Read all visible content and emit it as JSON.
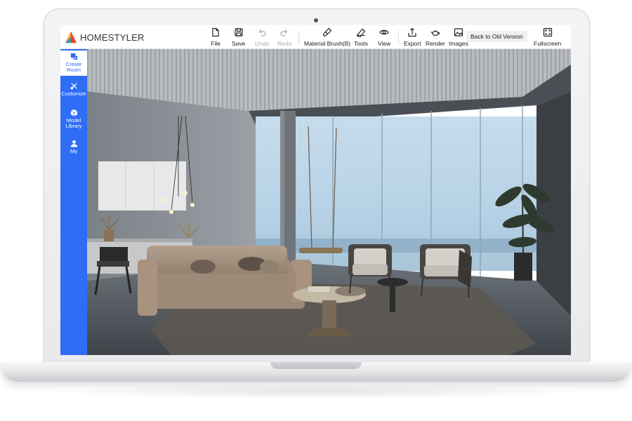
{
  "brand": {
    "name": "HOMESTYLER"
  },
  "toolbar": {
    "items": [
      {
        "id": "file",
        "label": "File",
        "icon": "file-icon",
        "disabled": false
      },
      {
        "id": "save",
        "label": "Save",
        "icon": "save-icon",
        "disabled": false
      },
      {
        "id": "undo",
        "label": "Undo",
        "icon": "undo-icon",
        "disabled": true
      },
      {
        "id": "redo",
        "label": "Redo",
        "icon": "redo-icon",
        "disabled": true
      },
      {
        "id": "material-brush",
        "label": "Material Brush(B)",
        "icon": "paint-brush-icon",
        "disabled": false
      },
      {
        "id": "tools",
        "label": "Tools",
        "icon": "ruler-icon",
        "disabled": false
      },
      {
        "id": "view",
        "label": "View",
        "icon": "eye-icon",
        "disabled": false
      },
      {
        "id": "export",
        "label": "Export",
        "icon": "export-icon",
        "disabled": false
      },
      {
        "id": "render",
        "label": "Render",
        "icon": "teapot-icon",
        "disabled": false
      },
      {
        "id": "images",
        "label": "Images",
        "icon": "image-icon",
        "disabled": false
      }
    ],
    "old_version_label": "Back to Old Version",
    "fullscreen_label": "Fullscreen"
  },
  "sidebar": {
    "items": [
      {
        "id": "create-room",
        "label": "Create Room",
        "icon": "create-room-icon",
        "active": true
      },
      {
        "id": "customize",
        "label": "Customize",
        "icon": "tools-cross-icon",
        "active": false
      },
      {
        "id": "model-library",
        "label": "Model Library",
        "icon": "cube-icon",
        "active": false
      },
      {
        "id": "my",
        "label": "My",
        "icon": "user-icon",
        "active": false
      }
    ]
  },
  "colors": {
    "brand_blue": "#2f6df6",
    "toolbar_bg": "#ffffff",
    "text_dark": "#222222",
    "disabled_text": "#aaaaaa"
  }
}
